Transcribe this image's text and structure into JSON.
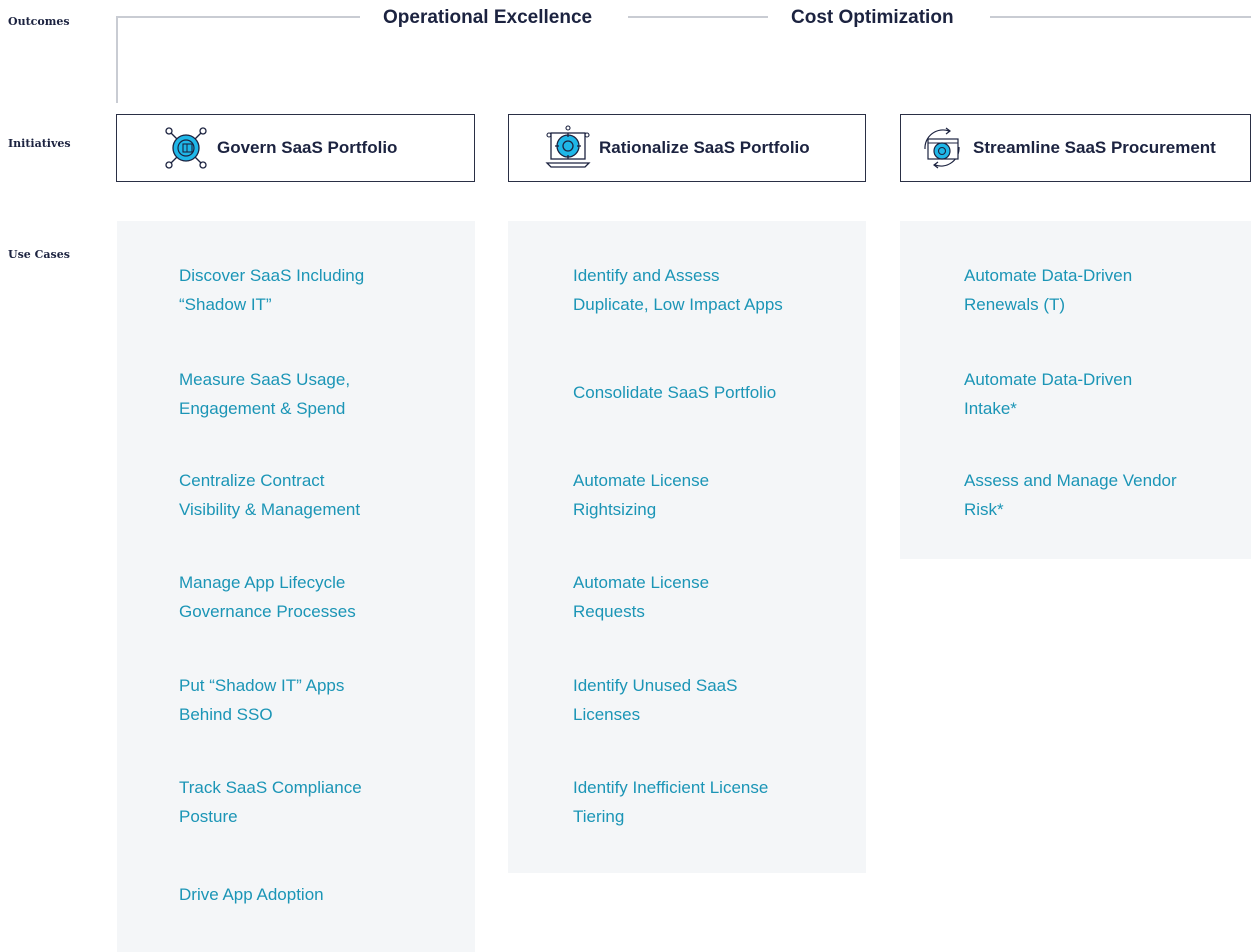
{
  "rows": {
    "outcomes": "Outcomes",
    "initiatives": "Initiatives",
    "use_cases": "Use Cases"
  },
  "outcomes": [
    {
      "title": "Operational Excellence"
    },
    {
      "title": "Cost Optimization"
    }
  ],
  "initiatives": [
    {
      "label": "Govern SaaS Portfolio",
      "icon": "network-hub-icon"
    },
    {
      "label": "Rationalize SaaS Portfolio",
      "icon": "laptop-gear-icon"
    },
    {
      "label": "Streamline SaaS Procurement",
      "icon": "browser-cycle-icon"
    }
  ],
  "columns": [
    {
      "use_cases": [
        "Discover SaaS Including\n“Shadow IT”",
        "Measure SaaS Usage,\nEngagement & Spend",
        "Centralize Contract\nVisibility & Management",
        "Manage App Lifecycle\nGovernance Processes",
        "Put “Shadow IT” Apps\nBehind SSO",
        "Track SaaS Compliance\nPosture",
        "Drive App Adoption"
      ]
    },
    {
      "use_cases": [
        "Identify and Assess\nDuplicate, Low Impact Apps",
        "Consolidate SaaS Portfolio",
        "Automate License\nRightsizing",
        "Automate License\nRequests",
        "Identify Unused SaaS\nLicenses",
        "Identify Inefficient License\nTiering"
      ]
    },
    {
      "use_cases": [
        "Automate Data-Driven\nRenewals (T)",
        "Automate Data-Driven\nIntake*",
        "Assess and Manage Vendor\nRisk*"
      ]
    }
  ],
  "colors": {
    "accent": "#1b95b6",
    "icon_fill": "#1fb7e8",
    "heading": "#1c2340",
    "panel": "#f4f6f8"
  }
}
